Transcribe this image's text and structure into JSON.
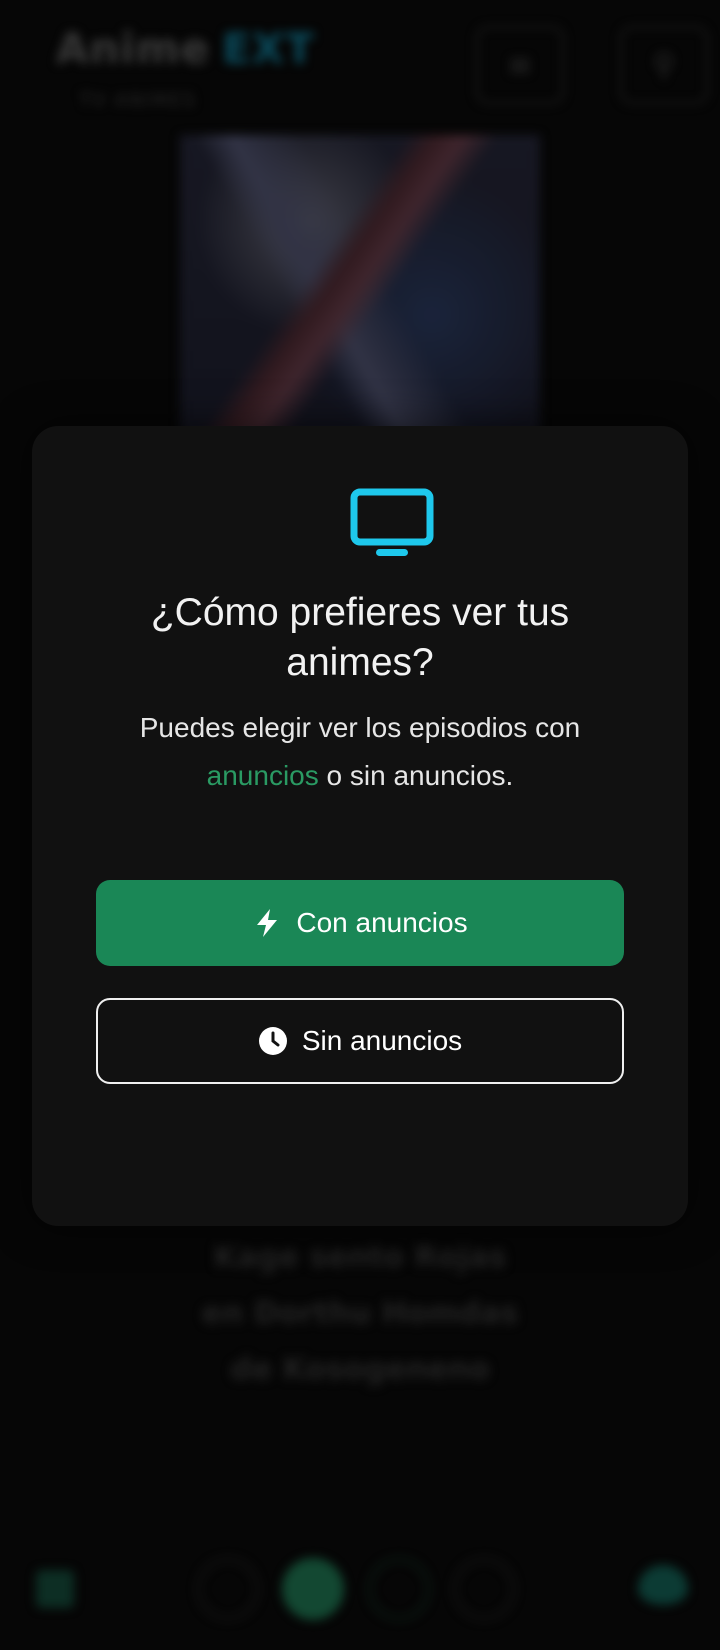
{
  "background": {
    "logo": {
      "main": "Anime",
      "accent": "EXT"
    },
    "logo_subtitle": "TV ANIMES",
    "header_buttons": [
      {
        "icon": "menu-icon"
      },
      {
        "icon": "search-icon"
      }
    ],
    "poster": {
      "icon": "anime-poster"
    },
    "title_lines": [
      "Kage sento Rojas",
      "en Dorthu Homdas",
      "de Kosogeneno"
    ],
    "bottom_nav": [
      {
        "icon": "home-icon"
      },
      {
        "icon": "nav-circle-icon"
      },
      {
        "icon": "play-icon"
      },
      {
        "icon": "nav-circle-icon"
      },
      {
        "icon": "nav-circle-icon"
      },
      {
        "icon": "heart-icon"
      }
    ]
  },
  "modal": {
    "icon": "tv-icon",
    "accent_color": "#1ec8ec",
    "title": "¿Cómo prefieres ver tus animes?",
    "description_before": "Puedes elegir ver los episodios con",
    "description_highlight": "anuncios",
    "description_after": " o sin anuncios.",
    "highlight_color": "#2a9a63",
    "options": [
      {
        "label": "Con anuncios",
        "icon": "bolt-icon",
        "style": "filled",
        "color": "#1a8756"
      },
      {
        "label": "Sin anuncios",
        "icon": "clock-icon",
        "style": "outline",
        "color": "#f0f0f0"
      }
    ]
  }
}
